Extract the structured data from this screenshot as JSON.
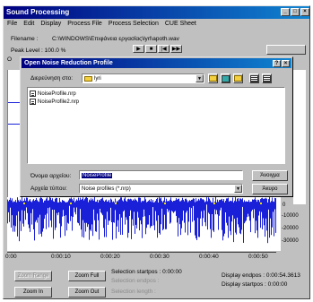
{
  "window": {
    "title": "Sound Processing",
    "caption_buttons": [
      "_",
      "□",
      "×"
    ]
  },
  "menu": [
    "File",
    "Edit",
    "Display",
    "Process File",
    "Process Selection",
    "CUE Sheet"
  ],
  "info": {
    "filename_label": "Filename :",
    "filename_value": "C:\\WINDOWS\\Επιφάνεια εργασίας\\lyrl\\apoth.wav",
    "peak_label": "Peak Level : 100.0 %",
    "peak_left_clip": "O"
  },
  "transport": [
    "▶",
    "■",
    "|◀",
    "▶▶"
  ],
  "dialog": {
    "title": "Open Noise Reduction Profile",
    "lookin_label": "Διερεύνηση στο:",
    "lookin_value": "lyri",
    "files": [
      "NoiseProfile.nrp",
      "NoiseProfile2.nrp"
    ],
    "filename_label": "Όνομα αρχείου:",
    "filename_value": "NoiseProfile",
    "filetype_label": "Αρχεία τύπου:",
    "filetype_value": "Noise profiles (*.nrp)",
    "open_button": "Άνοιγμα",
    "cancel_button": "Άκυρο",
    "caption_buttons": [
      "?",
      "×"
    ]
  },
  "axis": {
    "y_ticks": [
      "0",
      "-10000",
      "-20000",
      "-30000"
    ],
    "x_ticks": [
      "0:00",
      "0:00:10",
      "0:00:20",
      "0:00:30",
      "0:00:40",
      "0:00:50"
    ]
  },
  "controls": {
    "zoom_range": "Zoom Range",
    "zoom_full": "Zoom Full",
    "zoom_in": "Zoom In",
    "zoom_out": "Zoom Out",
    "sel_start": "Selection startpos :  0:00:00",
    "sel_end": "Selection endpos :",
    "sel_length": "Selection length :",
    "disp_end": "Display endpos :  0:00:54.3613",
    "disp_start": "Display startpos :  0:00:00"
  },
  "colors": {
    "wave": "#1a20d8",
    "titlebar": "#000080"
  }
}
